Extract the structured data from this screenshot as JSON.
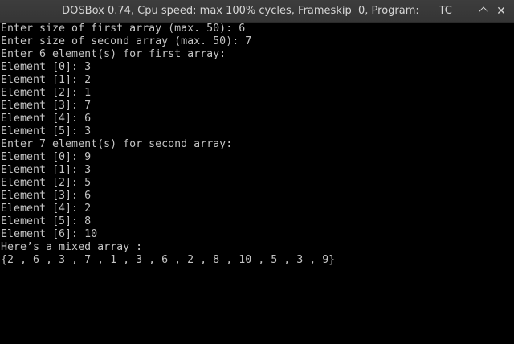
{
  "window": {
    "title": "DOSBox 0.74, Cpu speed: max 100% cycles, Frameskip  0, Program:      TC",
    "minimize_icon": "minimize-icon",
    "maximize_icon": "maximize-icon",
    "close_icon": "close-icon",
    "close_glyph": "✕"
  },
  "terminal": {
    "lines": [
      "Enter size of first array (max. 50): 6",
      "Enter size of second array (max. 50): 7",
      "Enter 6 element(s) for first array:",
      "Element [0]: 3",
      "Element [1]: 2",
      "Element [2]: 1",
      "Element [3]: 7",
      "Element [4]: 6",
      "Element [5]: 3",
      "Enter 7 element(s) for second array:",
      "Element [0]: 9",
      "Element [1]: 3",
      "Element [2]: 5",
      "Element [3]: 6",
      "Element [4]: 2",
      "Element [5]: 8",
      "Element [6]: 10",
      "Here’s a mixed array :",
      "{2 , 6 , 3 , 7 , 1 , 3 , 6 , 2 , 8 , 10 , 5 , 3 , 9}"
    ]
  }
}
